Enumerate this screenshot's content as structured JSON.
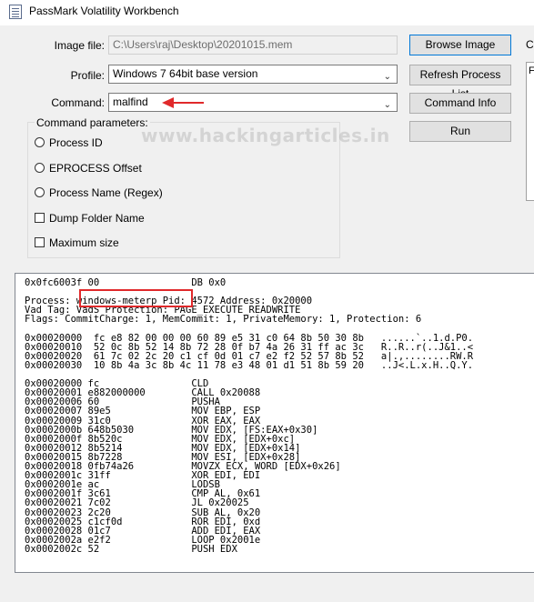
{
  "window": {
    "title": "PassMark Volatility Workbench"
  },
  "form": {
    "image_file_label": "Image file:",
    "image_file_value": "C:\\Users\\raj\\Desktop\\20201015.mem",
    "profile_label": "Profile:",
    "profile_value": "Windows 7 64bit base version",
    "command_label": "Command:",
    "command_value": "malfind"
  },
  "buttons": {
    "browse_image": "Browse Image",
    "refresh_process_list": "Refresh Process List",
    "command_info": "Command Info",
    "run": "Run"
  },
  "command_parameters": {
    "title": "Command parameters:",
    "options": [
      "Process ID",
      "EPROCESS Offset",
      "Process Name (Regex)",
      "Dump Folder Name",
      "Maximum size"
    ]
  },
  "right_panel": {
    "header_cut": "Co",
    "field_cut": "F"
  },
  "watermark": "www.hackingarticles.in",
  "output": {
    "lines": [
      "0x0fc6003f 00                DB 0x0",
      "",
      "Process: windows-meterp Pid: 4572 Address: 0x20000",
      "Vad Tag: VadS Protection: PAGE_EXECUTE_READWRITE",
      "Flags: CommitCharge: 1, MemCommit: 1, PrivateMemory: 1, Protection: 6",
      "",
      "0x00020000  fc e8 82 00 00 00 60 89 e5 31 c0 64 8b 50 30 8b   ......`..1.d.P0.",
      "0x00020010  52 0c 8b 52 14 8b 72 28 0f b7 4a 26 31 ff ac 3c   R..R..r(..J&1..<",
      "0x00020020  61 7c 02 2c 20 c1 cf 0d 01 c7 e2 f2 52 57 8b 52   a|.,........RW.R",
      "0x00020030  10 8b 4a 3c 8b 4c 11 78 e3 48 01 d1 51 8b 59 20   ..J<.L.x.H..Q.Y.",
      "",
      "0x00020000 fc                CLD",
      "0x00020001 e882000000        CALL 0x20088",
      "0x00020006 60                PUSHA",
      "0x00020007 89e5              MOV EBP, ESP",
      "0x00020009 31c0              XOR EAX, EAX",
      "0x0002000b 648b5030          MOV EDX, [FS:EAX+0x30]",
      "0x0002000f 8b520c            MOV EDX, [EDX+0xc]",
      "0x00020012 8b5214            MOV EDX, [EDX+0x14]",
      "0x00020015 8b7228            MOV ESI, [EDX+0x28]",
      "0x00020018 0fb74a26          MOVZX ECX, WORD [EDX+0x26]",
      "0x0002001c 31ff              XOR EDI, EDI",
      "0x0002001e ac                LODSB",
      "0x0002001f 3c61              CMP AL, 0x61",
      "0x00020021 7c02              JL 0x20025",
      "0x00020023 2c20              SUB AL, 0x20",
      "0x00020025 c1cf0d            ROR EDI, 0xd",
      "0x00020028 01c7              ADD EDI, EAX",
      "0x0002002a e2f2              LOOP 0x2001e",
      "0x0002002c 52                PUSH EDX"
    ]
  },
  "colors": {
    "annotation": "#e0292b",
    "focus_border": "#0078d7"
  }
}
